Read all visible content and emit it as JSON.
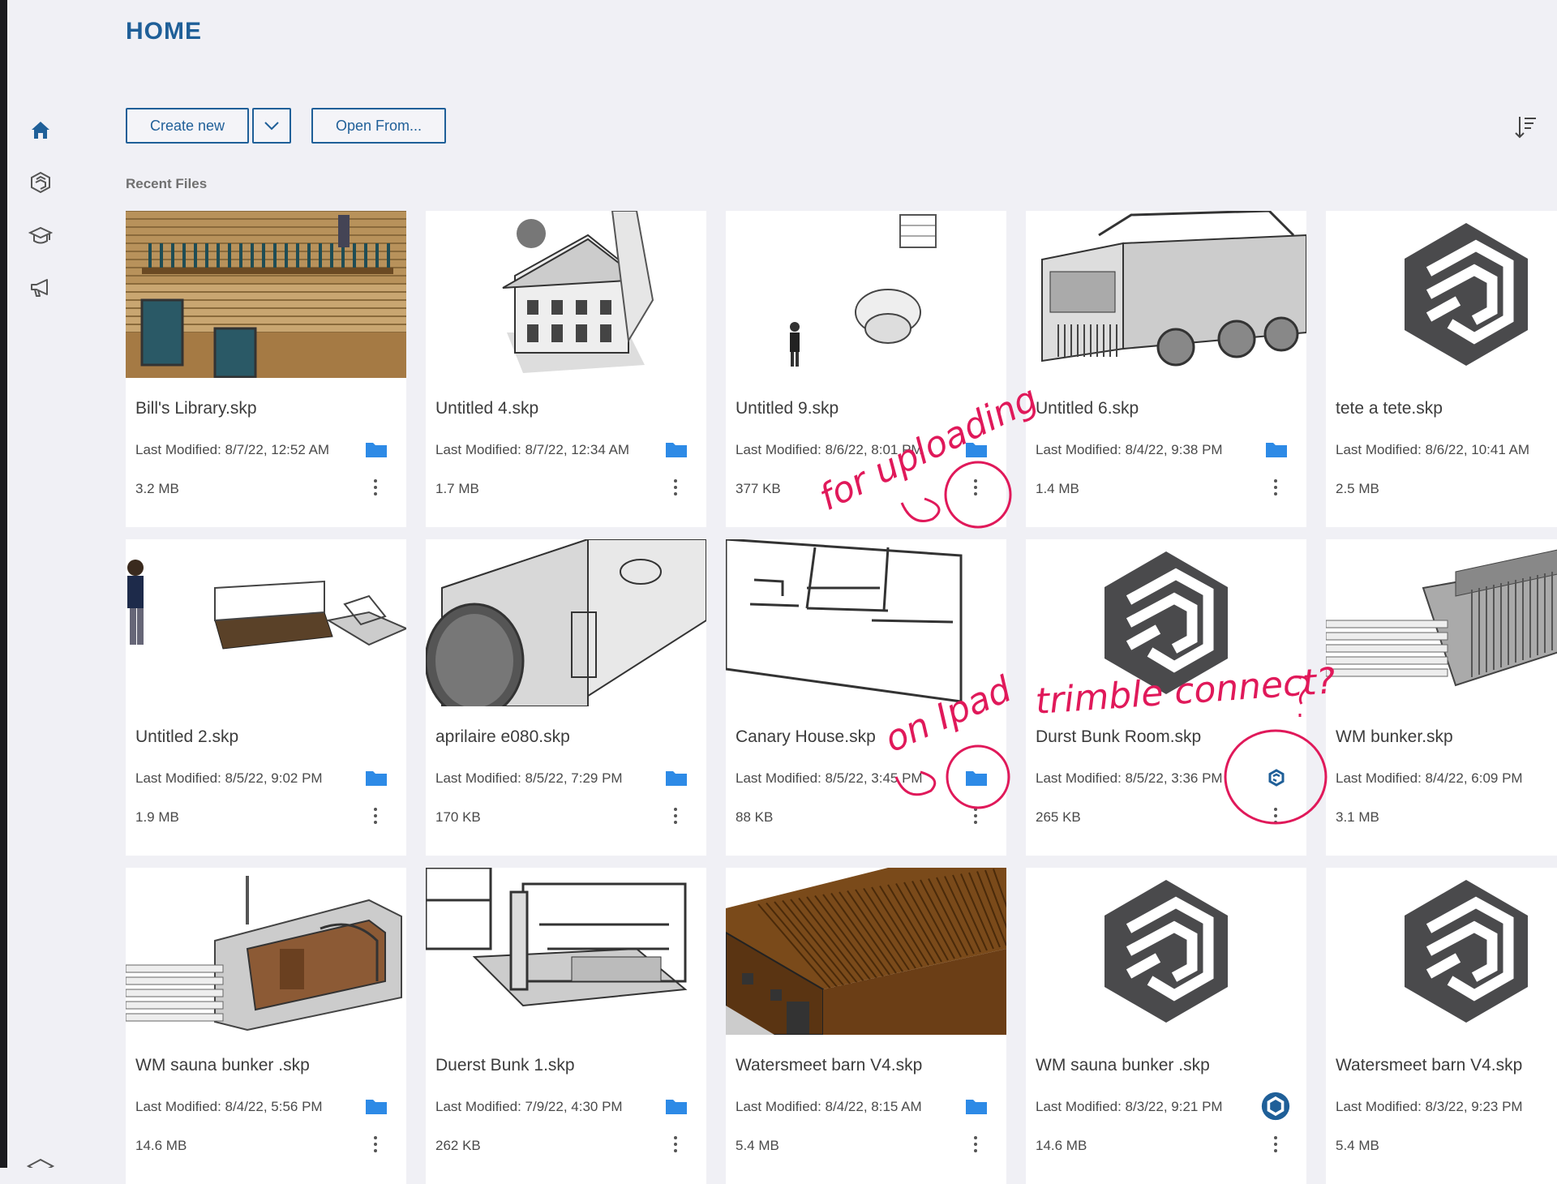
{
  "page": {
    "title": "HOME"
  },
  "sidebar": {
    "items": [
      {
        "icon": "home-icon",
        "active": true
      },
      {
        "icon": "trimble-connect-icon"
      },
      {
        "icon": "graduation-cap-icon"
      },
      {
        "icon": "megaphone-icon"
      }
    ]
  },
  "toolbar": {
    "create_label": "Create new",
    "open_label": "Open From..."
  },
  "recent": {
    "label": "Recent Files"
  },
  "files": [
    {
      "name": "Bill's Library.skp",
      "modified": "Last Modified: 8/7/22, 12:52 AM",
      "size": "3.2 MB",
      "location": "folder",
      "thumb": "library"
    },
    {
      "name": "Untitled 4.skp",
      "modified": "Last Modified: 8/7/22, 12:34 AM",
      "size": "1.7 MB",
      "location": "folder",
      "thumb": "house"
    },
    {
      "name": "Untitled 9.skp",
      "modified": "Last Modified: 8/6/22, 8:01 PM",
      "size": "377 KB",
      "location": "folder",
      "thumb": "figure"
    },
    {
      "name": "Untitled 6.skp",
      "modified": "Last Modified: 8/4/22, 9:38 PM",
      "size": "1.4 MB",
      "location": "folder",
      "thumb": "truck"
    },
    {
      "name": "tete a tete.skp",
      "modified": "Last Modified: 8/6/22, 10:41 AM",
      "size": "2.5 MB",
      "location": "none",
      "thumb": "logo"
    },
    {
      "name": "Untitled 2.skp",
      "modified": "Last Modified: 8/5/22, 9:02 PM",
      "size": "1.9 MB",
      "location": "folder",
      "thumb": "bench"
    },
    {
      "name": "aprilaire e080.skp",
      "modified": "Last Modified: 8/5/22, 7:29 PM",
      "size": "170 KB",
      "location": "folder",
      "thumb": "box"
    },
    {
      "name": "Canary House.skp",
      "modified": "Last Modified: 8/5/22, 3:45 PM",
      "size": "88 KB",
      "location": "folder",
      "thumb": "plan"
    },
    {
      "name": "Durst Bunk Room.skp",
      "modified": "Last Modified: 8/5/22, 3:36 PM",
      "size": "265 KB",
      "location": "connect",
      "thumb": "logo"
    },
    {
      "name": "WM bunker.skp",
      "modified": "Last Modified: 8/4/22, 6:09 PM",
      "size": "3.1 MB",
      "location": "none",
      "thumb": "bunker"
    },
    {
      "name": "WM sauna bunker .skp",
      "modified": "Last Modified: 8/4/22, 5:56 PM",
      "size": "14.6 MB",
      "location": "folder",
      "thumb": "sauna"
    },
    {
      "name": "Duerst Bunk 1.skp",
      "modified": "Last Modified: 7/9/22, 4:30 PM",
      "size": "262 KB",
      "location": "folder",
      "thumb": "bunk"
    },
    {
      "name": "Watersmeet barn V4.skp",
      "modified": "Last Modified: 8/4/22, 8:15 AM",
      "size": "5.4 MB",
      "location": "folder",
      "thumb": "barn"
    },
    {
      "name": "WM sauna bunker .skp",
      "modified": "Last Modified: 8/3/22, 9:21 PM",
      "size": "14.6 MB",
      "location": "connect-filled",
      "thumb": "logo"
    },
    {
      "name": "Watersmeet barn V4.skp",
      "modified": "Last Modified: 8/3/22, 9:23 PM",
      "size": "5.4 MB",
      "location": "none",
      "thumb": "logo"
    }
  ],
  "annotations": {
    "note1": "for uploading",
    "note2": "on Ipad",
    "note3": "trimble connect?",
    "color": "#e0195a"
  },
  "colors": {
    "accent": "#1f5f98",
    "folder": "#2d8ae6",
    "connect": "#1f5f98",
    "background": "#f0f0f5"
  }
}
